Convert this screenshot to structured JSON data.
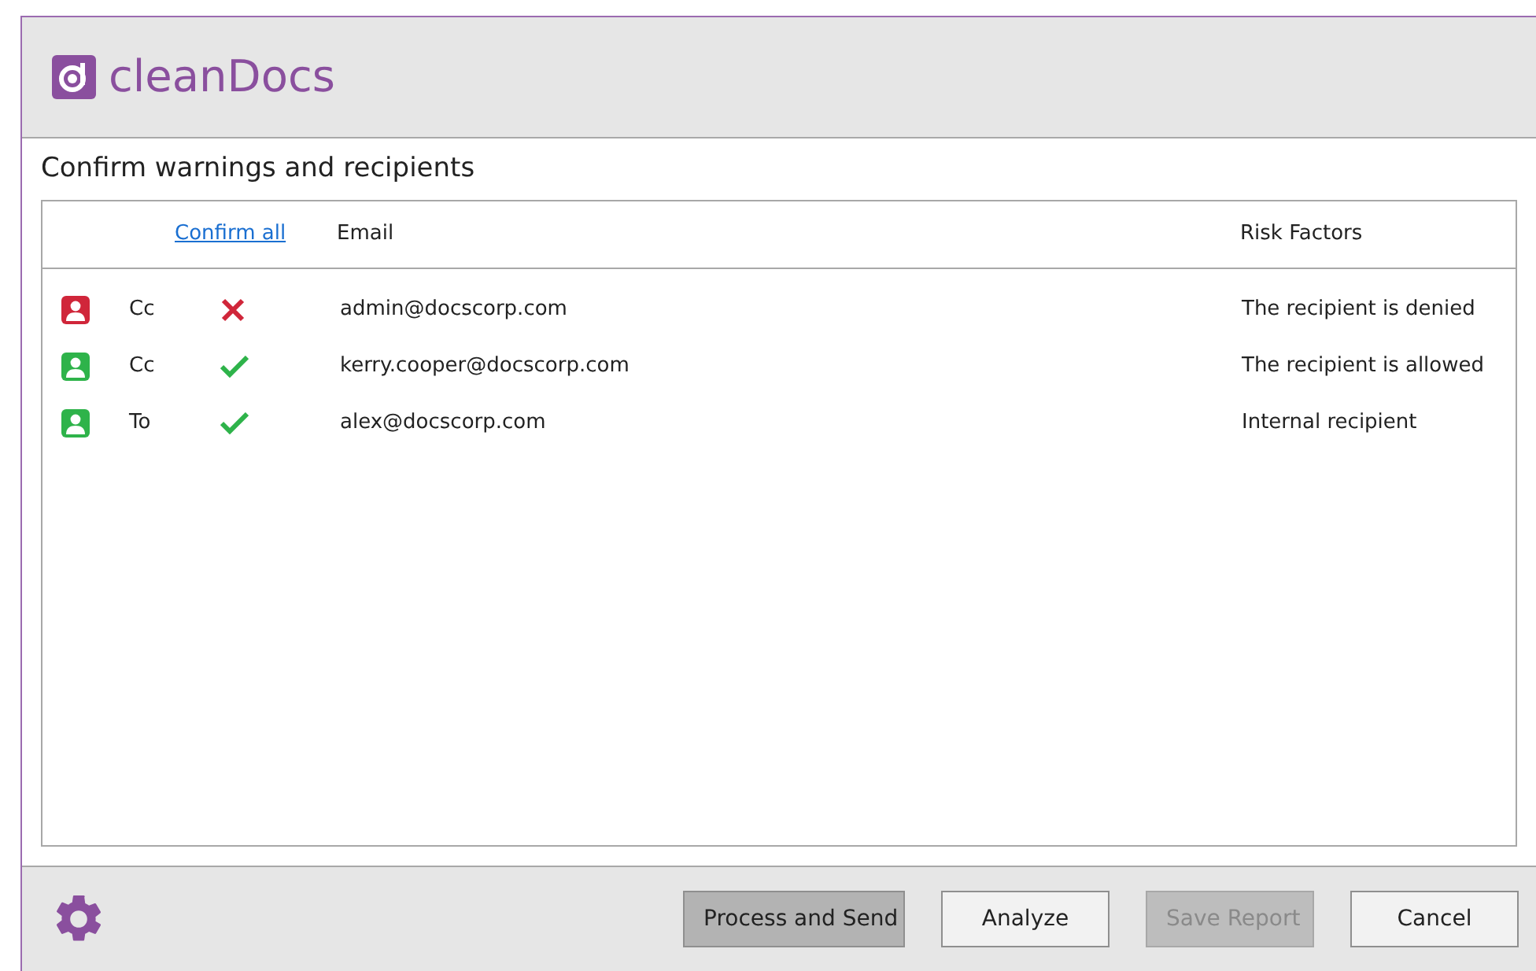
{
  "app": {
    "logo_text": "cleanDocs"
  },
  "heading": "Confirm warnings and recipients",
  "table": {
    "confirm_all": "Confirm all",
    "columns": [
      "Email",
      "Risk Factors"
    ],
    "rows": [
      {
        "kind": "denied",
        "field": "Cc",
        "email": "admin@docscorp.com",
        "risk": "The recipient is denied"
      },
      {
        "kind": "allowed",
        "field": "Cc",
        "email": "kerry.cooper@docscorp.com",
        "risk": "The recipient is allowed"
      },
      {
        "kind": "allowed",
        "field": "To",
        "email": "alex@docscorp.com",
        "risk": "Internal recipient"
      }
    ]
  },
  "buttons": [
    {
      "label": "Process and Send",
      "kind": "primary",
      "disabled": false
    },
    {
      "label": "Analyze",
      "kind": "normal",
      "disabled": false
    },
    {
      "label": "Save Report",
      "kind": "normal",
      "disabled": true
    },
    {
      "label": "Cancel",
      "kind": "normal",
      "disabled": false
    }
  ]
}
